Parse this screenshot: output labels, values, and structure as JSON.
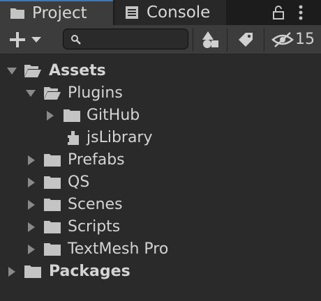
{
  "tabs": [
    {
      "label": "Project",
      "icon": "folder-icon",
      "active": true
    },
    {
      "label": "Console",
      "icon": "console-icon",
      "active": false
    }
  ],
  "toolbar": {
    "create_icon": "plus-icon",
    "search_placeholder": "",
    "search_value": "",
    "hidden_count": "15"
  },
  "tree": {
    "assets": {
      "label": "Assets",
      "expanded": true
    },
    "plugins": {
      "label": "Plugins",
      "expanded": true
    },
    "github": {
      "label": "GitHub",
      "expanded": false
    },
    "jslibrary": {
      "label": "jsLibrary",
      "icon": "plugin-icon"
    },
    "prefabs": {
      "label": "Prefabs",
      "expanded": false
    },
    "qs": {
      "label": "QS",
      "expanded": false
    },
    "scenes": {
      "label": "Scenes",
      "expanded": false
    },
    "scripts": {
      "label": "Scripts",
      "expanded": false
    },
    "textmesh": {
      "label": "TextMesh Pro",
      "expanded": false
    },
    "packages": {
      "label": "Packages",
      "expanded": false
    }
  },
  "colors": {
    "accent": "#3a79bb",
    "panel": "#2a2a2a",
    "toolbar": "#3c3c3c",
    "icon": "#c4c4c4"
  }
}
